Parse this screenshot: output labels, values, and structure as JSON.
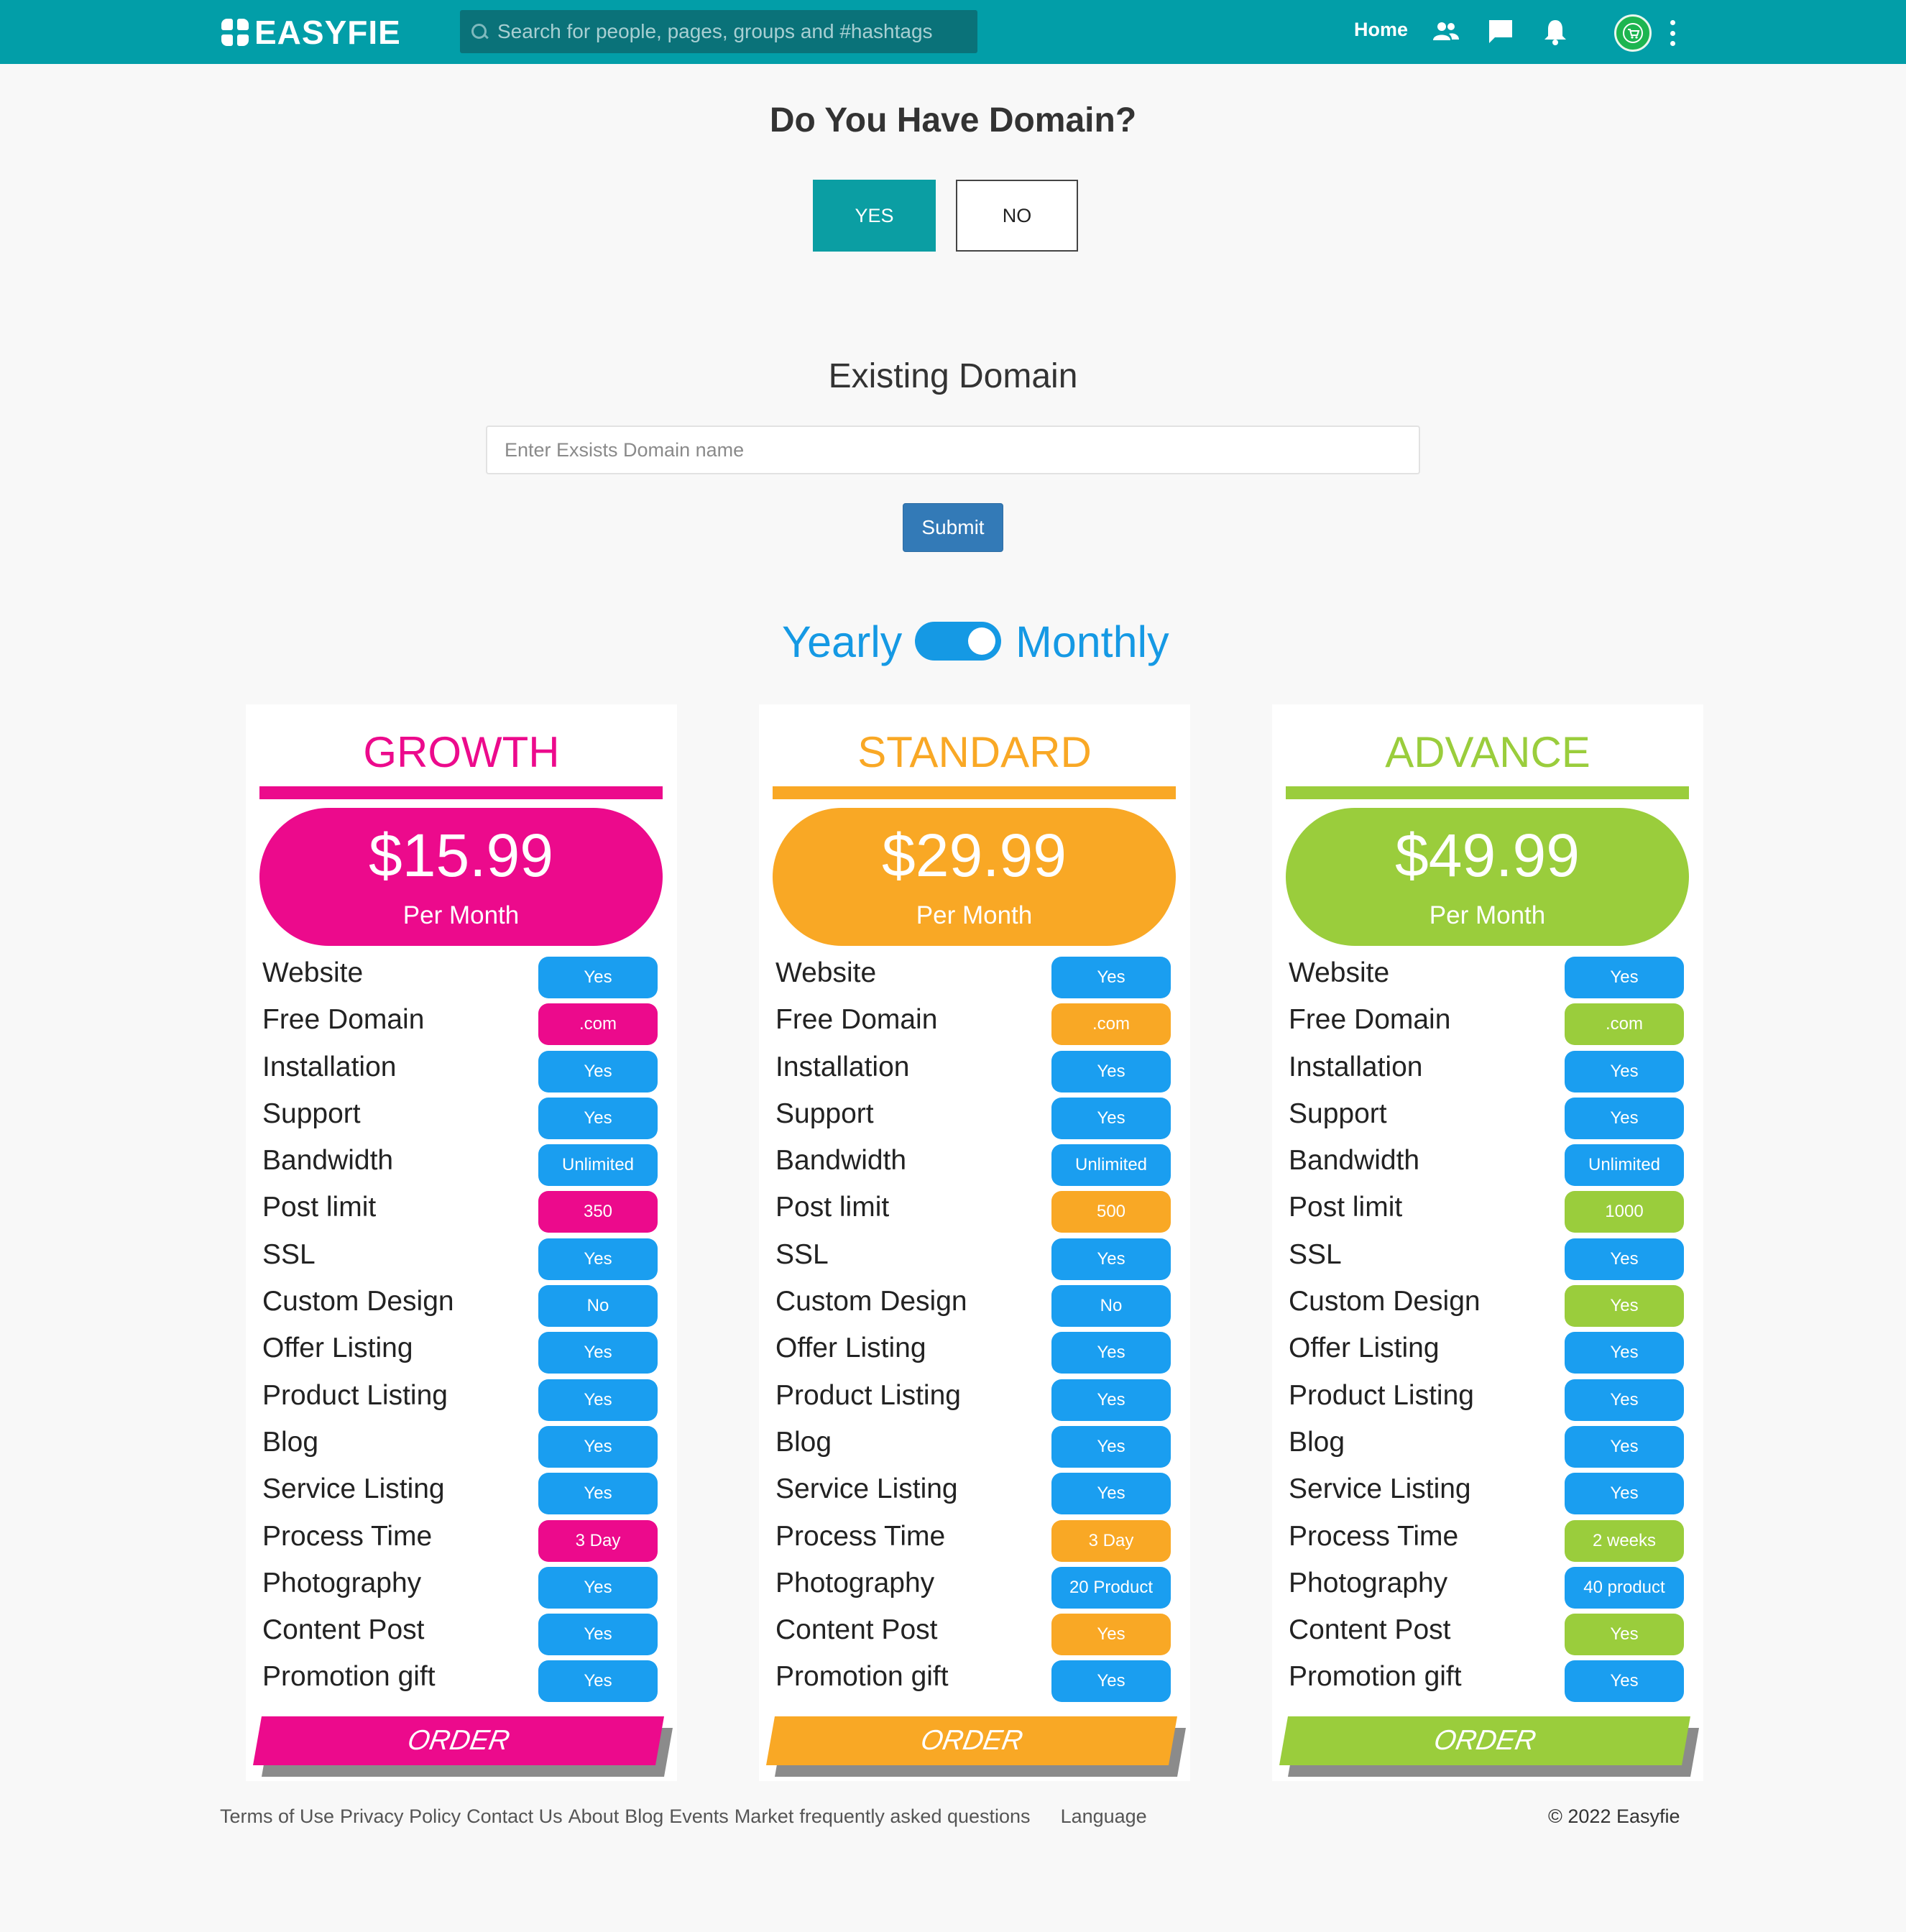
{
  "header": {
    "logo_text": "EASYFIE",
    "search_placeholder": "Search for people, pages, groups and #hashtags",
    "home_label": "Home"
  },
  "domain_question": {
    "title": "Do You Have Domain?",
    "yes_label": "YES",
    "no_label": "NO"
  },
  "existing_domain": {
    "title": "Existing Domain",
    "placeholder": "Enter Exsists Domain name",
    "submit_label": "Submit"
  },
  "billing": {
    "yearly_label": "Yearly",
    "monthly_label": "Monthly",
    "selected": "Monthly"
  },
  "colors": {
    "growth": "#ec0a8c",
    "standard": "#f9a825",
    "advance": "#9acd3c",
    "blue": "#1a9ef0",
    "teal": "#029ea8"
  },
  "plans": [
    {
      "name": "GROWTH",
      "price": "$15.99",
      "period": "Per Month",
      "color": "#ec0a8c",
      "order_label": "ORDER",
      "features": [
        {
          "label": "Website",
          "value": "Yes",
          "color": "#1a9ef0"
        },
        {
          "label": "Free Domain",
          "value": ".com",
          "color": "#ec0a8c"
        },
        {
          "label": "Installation",
          "value": "Yes",
          "color": "#1a9ef0"
        },
        {
          "label": "Support",
          "value": "Yes",
          "color": "#1a9ef0"
        },
        {
          "label": "Bandwidth",
          "value": "Unlimited",
          "color": "#1a9ef0"
        },
        {
          "label": "Post limit",
          "value": "350",
          "color": "#ec0a8c"
        },
        {
          "label": "SSL",
          "value": "Yes",
          "color": "#1a9ef0"
        },
        {
          "label": "Custom Design",
          "value": "No",
          "color": "#1a9ef0"
        },
        {
          "label": "Offer Listing",
          "value": "Yes",
          "color": "#1a9ef0"
        },
        {
          "label": "Product Listing",
          "value": "Yes",
          "color": "#1a9ef0"
        },
        {
          "label": "Blog",
          "value": "Yes",
          "color": "#1a9ef0"
        },
        {
          "label": "Service Listing",
          "value": "Yes",
          "color": "#1a9ef0"
        },
        {
          "label": "Process Time",
          "value": "3 Day",
          "color": "#ec0a8c"
        },
        {
          "label": "Photography",
          "value": "Yes",
          "color": "#1a9ef0"
        },
        {
          "label": "Content Post",
          "value": "Yes",
          "color": "#1a9ef0"
        },
        {
          "label": "Promotion gift",
          "value": "Yes",
          "color": "#1a9ef0"
        }
      ]
    },
    {
      "name": "STANDARD",
      "price": "$29.99",
      "period": "Per Month",
      "color": "#f9a825",
      "order_label": "ORDER",
      "features": [
        {
          "label": "Website",
          "value": "Yes",
          "color": "#1a9ef0"
        },
        {
          "label": "Free Domain",
          "value": ".com",
          "color": "#f9a825"
        },
        {
          "label": "Installation",
          "value": "Yes",
          "color": "#1a9ef0"
        },
        {
          "label": "Support",
          "value": "Yes",
          "color": "#1a9ef0"
        },
        {
          "label": "Bandwidth",
          "value": "Unlimited",
          "color": "#1a9ef0"
        },
        {
          "label": "Post limit",
          "value": "500",
          "color": "#f9a825"
        },
        {
          "label": "SSL",
          "value": "Yes",
          "color": "#1a9ef0"
        },
        {
          "label": "Custom Design",
          "value": "No",
          "color": "#1a9ef0"
        },
        {
          "label": "Offer Listing",
          "value": "Yes",
          "color": "#1a9ef0"
        },
        {
          "label": "Product Listing",
          "value": "Yes",
          "color": "#1a9ef0"
        },
        {
          "label": "Blog",
          "value": "Yes",
          "color": "#1a9ef0"
        },
        {
          "label": "Service Listing",
          "value": "Yes",
          "color": "#1a9ef0"
        },
        {
          "label": "Process Time",
          "value": "3 Day",
          "color": "#f9a825"
        },
        {
          "label": "Photography",
          "value": "20 Product",
          "color": "#1a9ef0"
        },
        {
          "label": "Content Post",
          "value": "Yes",
          "color": "#f9a825"
        },
        {
          "label": "Promotion gift",
          "value": "Yes",
          "color": "#1a9ef0"
        }
      ]
    },
    {
      "name": "ADVANCE",
      "price": "$49.99",
      "period": "Per Month",
      "color": "#9acd3c",
      "order_label": "ORDER",
      "features": [
        {
          "label": "Website",
          "value": "Yes",
          "color": "#1a9ef0"
        },
        {
          "label": "Free Domain",
          "value": ".com",
          "color": "#9acd3c"
        },
        {
          "label": "Installation",
          "value": "Yes",
          "color": "#1a9ef0"
        },
        {
          "label": "Support",
          "value": "Yes",
          "color": "#1a9ef0"
        },
        {
          "label": "Bandwidth",
          "value": "Unlimited",
          "color": "#1a9ef0"
        },
        {
          "label": "Post limit",
          "value": "1000",
          "color": "#9acd3c"
        },
        {
          "label": "SSL",
          "value": "Yes",
          "color": "#1a9ef0"
        },
        {
          "label": "Custom Design",
          "value": "Yes",
          "color": "#9acd3c"
        },
        {
          "label": "Offer Listing",
          "value": "Yes",
          "color": "#1a9ef0"
        },
        {
          "label": "Product Listing",
          "value": "Yes",
          "color": "#1a9ef0"
        },
        {
          "label": "Blog",
          "value": "Yes",
          "color": "#1a9ef0"
        },
        {
          "label": "Service Listing",
          "value": "Yes",
          "color": "#1a9ef0"
        },
        {
          "label": "Process Time",
          "value": "2 weeks",
          "color": "#9acd3c"
        },
        {
          "label": "Photography",
          "value": "40 product",
          "color": "#1a9ef0"
        },
        {
          "label": "Content Post",
          "value": "Yes",
          "color": "#9acd3c"
        },
        {
          "label": "Promotion gift",
          "value": "Yes",
          "color": "#1a9ef0"
        }
      ]
    }
  ],
  "footer": {
    "links": [
      "Terms of Use",
      "Privacy Policy",
      "Contact Us",
      "About",
      "Blog",
      "Events",
      "Market",
      "frequently asked questions"
    ],
    "language_label": "Language",
    "copyright": "© 2022 Easyfie"
  },
  "icons": {
    "friends": "people-icon",
    "messages": "chat-icon",
    "notifications": "bell-icon",
    "menu": "more-vertical-icon"
  }
}
